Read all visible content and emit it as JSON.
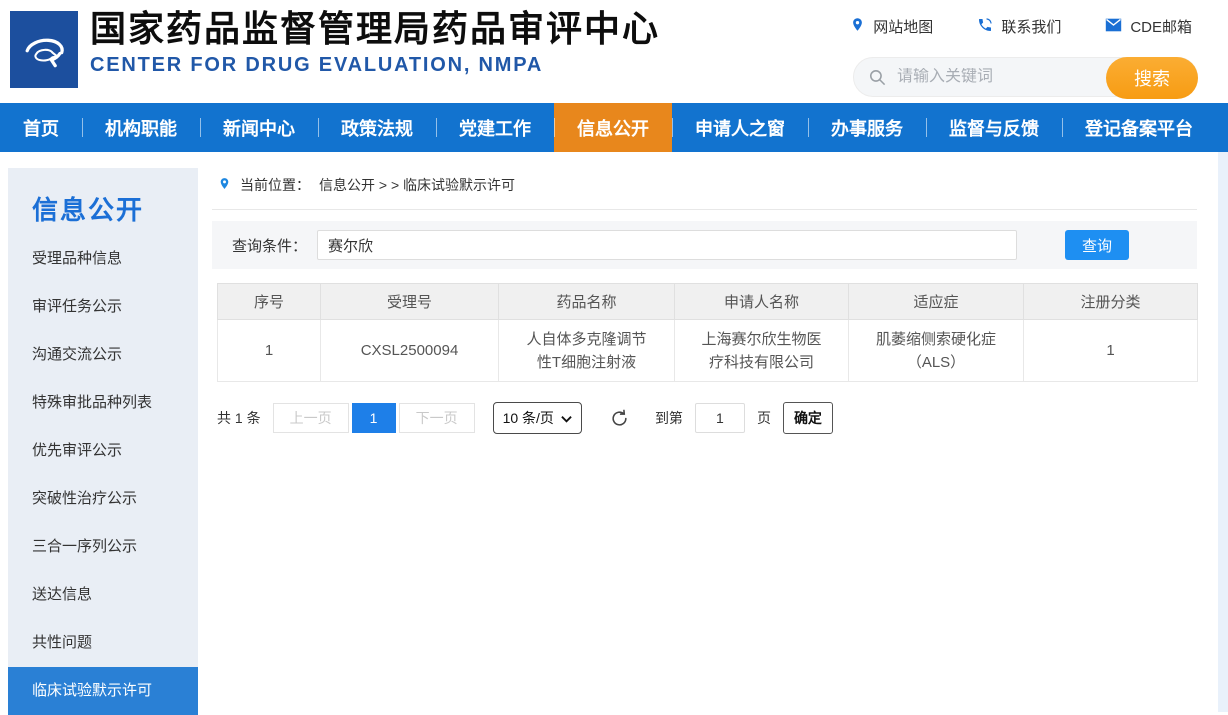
{
  "header": {
    "title": "国家药品监督管理局药品审评中心",
    "subtitle": "CENTER FOR DRUG EVALUATION, NMPA",
    "quick_links": [
      {
        "icon": "map-pin-icon",
        "label": "网站地图"
      },
      {
        "icon": "phone-icon",
        "label": "联系我们"
      },
      {
        "icon": "mail-icon",
        "label": "CDE邮箱"
      }
    ],
    "search": {
      "placeholder": "请输入关键词",
      "button_label": "搜索"
    }
  },
  "nav": {
    "items": [
      {
        "label": "首页",
        "active": false
      },
      {
        "label": "机构职能",
        "active": false
      },
      {
        "label": "新闻中心",
        "active": false
      },
      {
        "label": "政策法规",
        "active": false
      },
      {
        "label": "党建工作",
        "active": false
      },
      {
        "label": "信息公开",
        "active": true
      },
      {
        "label": "申请人之窗",
        "active": false
      },
      {
        "label": "办事服务",
        "active": false
      },
      {
        "label": "监督与反馈",
        "active": false
      },
      {
        "label": "登记备案平台",
        "active": false
      }
    ]
  },
  "sidebar": {
    "title": "信息公开",
    "items": [
      {
        "label": "受理品种信息",
        "active": false
      },
      {
        "label": "审评任务公示",
        "active": false
      },
      {
        "label": "沟通交流公示",
        "active": false
      },
      {
        "label": "特殊审批品种列表",
        "active": false
      },
      {
        "label": "优先审评公示",
        "active": false
      },
      {
        "label": "突破性治疗公示",
        "active": false
      },
      {
        "label": "三合一序列公示",
        "active": false
      },
      {
        "label": "送达信息",
        "active": false
      },
      {
        "label": "共性问题",
        "active": false
      },
      {
        "label": "临床试验默示许可",
        "active": true
      }
    ]
  },
  "breadcrumb": {
    "icon": "location-pin-icon",
    "prefix": "当前位置：",
    "trail": "信息公开 > > 临床试验默示许可"
  },
  "query": {
    "label": "查询条件：",
    "value": "赛尔欣",
    "button_label": "查询"
  },
  "results_table": {
    "columns": [
      "序号",
      "受理号",
      "药品名称",
      "申请人名称",
      "适应症",
      "注册分类"
    ],
    "rows": [
      [
        "1",
        "CXSL2500094",
        "人自体多克隆调节性T细胞注射液",
        "上海赛尔欣生物医疗科技有限公司",
        "肌萎缩侧索硬化症（ALS）",
        "1"
      ]
    ]
  },
  "pagination": {
    "total_label": "共 1 条",
    "prev_label": "上一页",
    "current_page": "1",
    "next_label": "下一页",
    "page_size_label": "10 条/页",
    "goto_prefix": "到第",
    "goto_value": "1",
    "goto_suffix": "页",
    "confirm_label": "确定"
  },
  "colors": {
    "nav_blue": "#1273cf",
    "active_orange": "#e8871c",
    "accent_blue": "#1e8ff2",
    "search_orange": "#f79c13",
    "sidebar_active_blue": "#2a80d5",
    "logo_blue": "#1c4f9e"
  }
}
